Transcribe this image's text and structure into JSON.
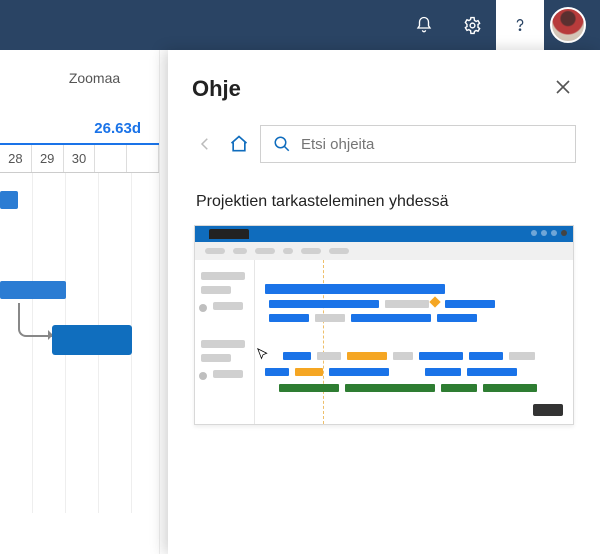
{
  "topbar": {
    "notifications_icon": "bell",
    "settings_icon": "gear",
    "help_icon": "question",
    "avatar": "user-avatar"
  },
  "left": {
    "zoom_label": "Zoomaa",
    "duration_label": "26.63d",
    "dates": [
      "28",
      "29",
      "30"
    ]
  },
  "help": {
    "title": "Ohje",
    "close": "✕",
    "search_placeholder": "Etsi ohjeita",
    "article_title": "Projektien tarkasteleminen yhdessä"
  }
}
